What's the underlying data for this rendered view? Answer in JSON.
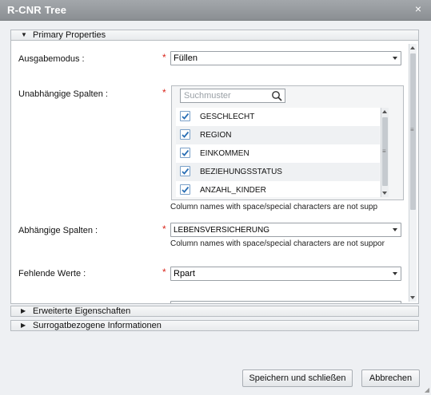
{
  "window": {
    "title": "R-CNR Tree",
    "close_label": "×"
  },
  "sections": {
    "primary": "Primary Properties",
    "advanced": "Erweiterte Eigenschaften",
    "surrogate": "Surrogatbezogene Informationen"
  },
  "form": {
    "output_mode": {
      "label": "Ausgabemodus :",
      "value": "Füllen"
    },
    "independent_columns": {
      "label": "Unabhängige Spalten :",
      "search_placeholder": "Suchmuster",
      "items": [
        {
          "label": "GESCHLECHT",
          "checked": true
        },
        {
          "label": "REGION",
          "checked": true
        },
        {
          "label": "EINKOMMEN",
          "checked": true
        },
        {
          "label": "BEZIEHUNGSSTATUS",
          "checked": true
        },
        {
          "label": "ANZAHL_KINDER",
          "checked": true
        }
      ],
      "hint": "Column names with space/special characters are not supp"
    },
    "dependent_columns": {
      "label": "Abhängige Spalten :",
      "value": "LEBENSVERSICHERUNG",
      "hint": "Column names with space/special characters are not suppor"
    },
    "missing_values": {
      "label": "Fehlende Werte :",
      "value": "Rpart"
    },
    "required_marker": "*"
  },
  "buttons": {
    "save": "Speichern und schließen",
    "cancel": "Abbrechen"
  },
  "colors": {
    "title_bg": "#979b9f",
    "required": "#d9261c",
    "checkbox_border": "#7aa0c8"
  }
}
